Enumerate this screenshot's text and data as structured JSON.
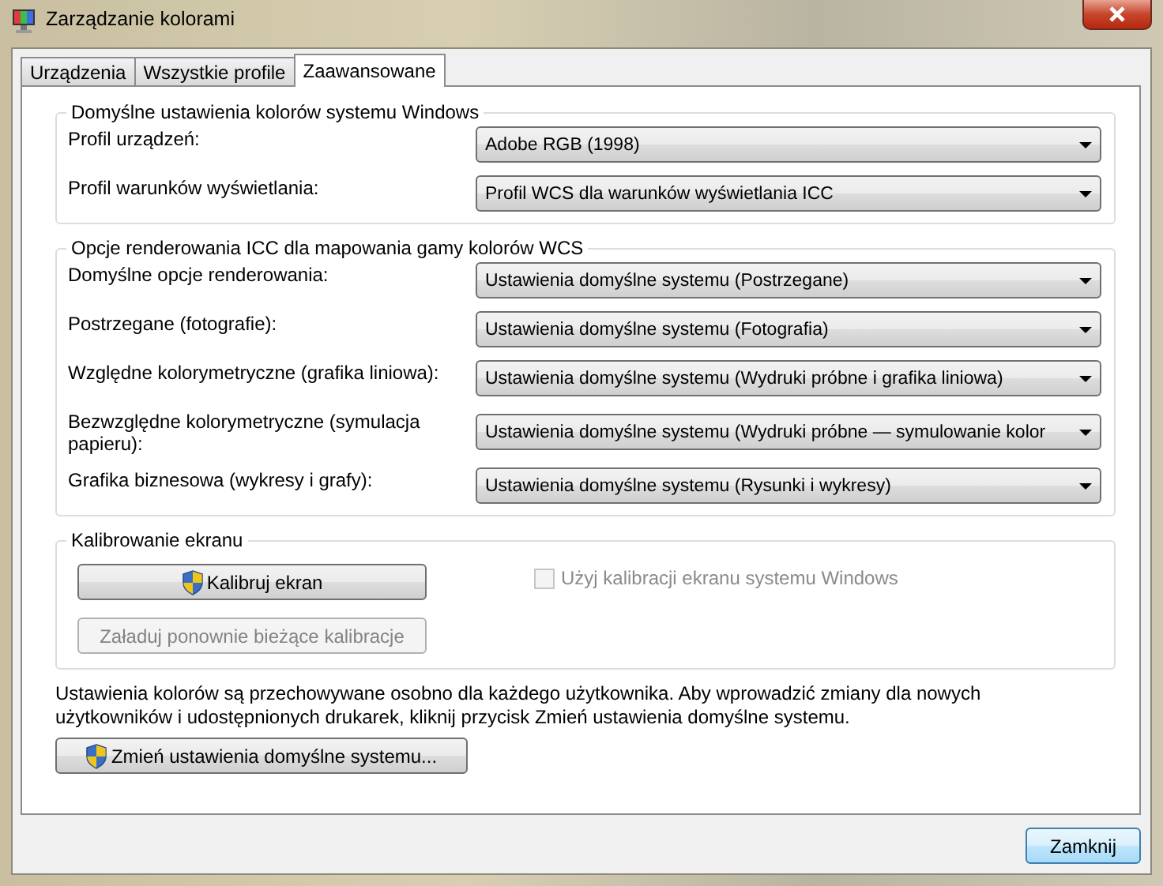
{
  "window": {
    "title": "Zarządzanie kolorami"
  },
  "tabs": [
    {
      "label": "Urządzenia",
      "selected": false
    },
    {
      "label": "Wszystkie profile",
      "selected": false
    },
    {
      "label": "Zaawansowane",
      "selected": true
    }
  ],
  "groups": [
    {
      "title": "Domyślne ustawienia kolorów systemu Windows",
      "rows": [
        {
          "label": "Profil urządzeń:",
          "value": "Adobe RGB (1998)"
        },
        {
          "label": "Profil warunków wyświetlania:",
          "value": "Profil WCS dla warunków wyświetlania ICC"
        }
      ]
    },
    {
      "title": "Opcje renderowania ICC dla mapowania gamy kolorów WCS",
      "rows": [
        {
          "label": "Domyślne opcje renderowania:",
          "value": "Ustawienia domyślne systemu (Postrzegane)"
        },
        {
          "label": "Postrzegane (fotografie):",
          "value": "Ustawienia domyślne systemu (Fotografia)"
        },
        {
          "label": "Względne kolorymetryczne (grafika liniowa):",
          "value": "Ustawienia domyślne systemu (Wydruki próbne i grafika liniowa)"
        },
        {
          "label": "Bezwzględne kolorymetryczne (symulacja papieru):",
          "value": "Ustawienia domyślne systemu (Wydruki próbne — symulowanie kolor"
        },
        {
          "label": "Grafika biznesowa (wykresy i grafy):",
          "value": "Ustawienia domyślne systemu (Rysunki i wykresy)"
        }
      ]
    }
  ],
  "calibration": {
    "title": "Kalibrowanie ekranu",
    "calibrate_button": {
      "label": "Kalibruj ekran",
      "disabled": false
    },
    "reload_button": {
      "label": "Załaduj ponownie bieżące kalibracje",
      "disabled": true
    },
    "checkbox": {
      "label": "Użyj kalibracji ekranu systemu Windows",
      "checked": false,
      "disabled": true
    }
  },
  "note": "Ustawienia kolorów są przechowywane osobno dla każdego użytkownika. Aby wprowadzić zmiany dla nowych użytkowników i udostępnionych drukarek, kliknij przycisk Zmień ustawienia domyślne systemu.",
  "defaults_button": {
    "label": "Zmień ustawienia domyślne systemu..."
  },
  "close_button": {
    "label": "Zamknij"
  }
}
